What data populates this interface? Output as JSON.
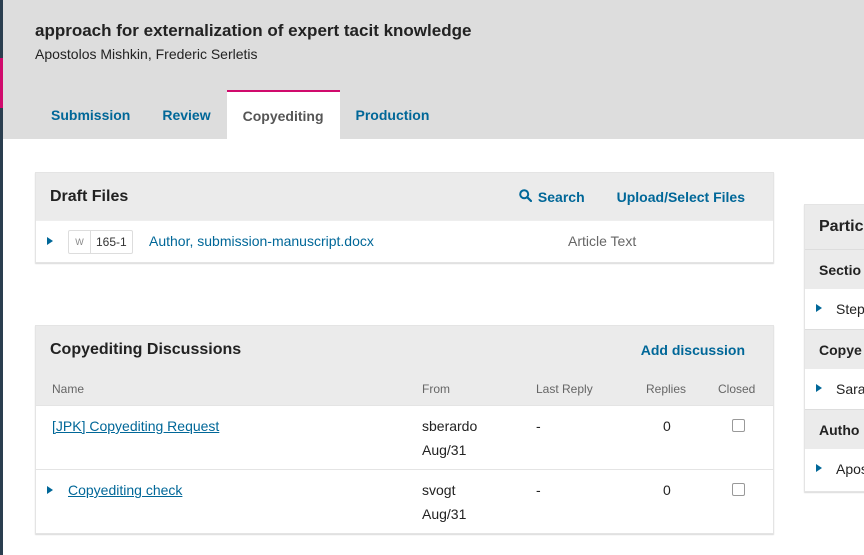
{
  "submission": {
    "title": "approach for externalization of expert tacit knowledge",
    "authors": "Apostolos Mishkin, Frederic Serletis"
  },
  "tabs": [
    {
      "label": "Submission"
    },
    {
      "label": "Review"
    },
    {
      "label": "Copyediting"
    },
    {
      "label": "Production"
    }
  ],
  "draft_files": {
    "title": "Draft Files",
    "search_label": "Search",
    "upload_label": "Upload/Select Files",
    "files": [
      {
        "id": "165-1",
        "name": "Author, submission-manuscript.docx",
        "genre": "Article Text"
      }
    ]
  },
  "discussions": {
    "title": "Copyediting Discussions",
    "add_label": "Add discussion",
    "columns": {
      "name": "Name",
      "from": "From",
      "last_reply": "Last Reply",
      "replies": "Replies",
      "closed": "Closed"
    },
    "rows": [
      {
        "name": "[JPK] Copyediting Request",
        "from_user": "sberardo",
        "from_date": "Aug/31",
        "last_reply": "-",
        "replies": "0",
        "closed": false
      },
      {
        "name": "Copyediting check",
        "from_user": "svogt",
        "from_date": "Aug/31",
        "last_reply": "-",
        "replies": "0",
        "closed": false
      }
    ]
  },
  "participants": {
    "title": "Partic",
    "sections": [
      {
        "label": "Sectio",
        "item": "Step"
      },
      {
        "label": "Copye",
        "item": "Sara"
      },
      {
        "label": "Autho",
        "item": "Apos"
      }
    ]
  },
  "colors": {
    "accent": "#d00a6c",
    "link": "#006798",
    "rail": "#2a3e4f"
  }
}
